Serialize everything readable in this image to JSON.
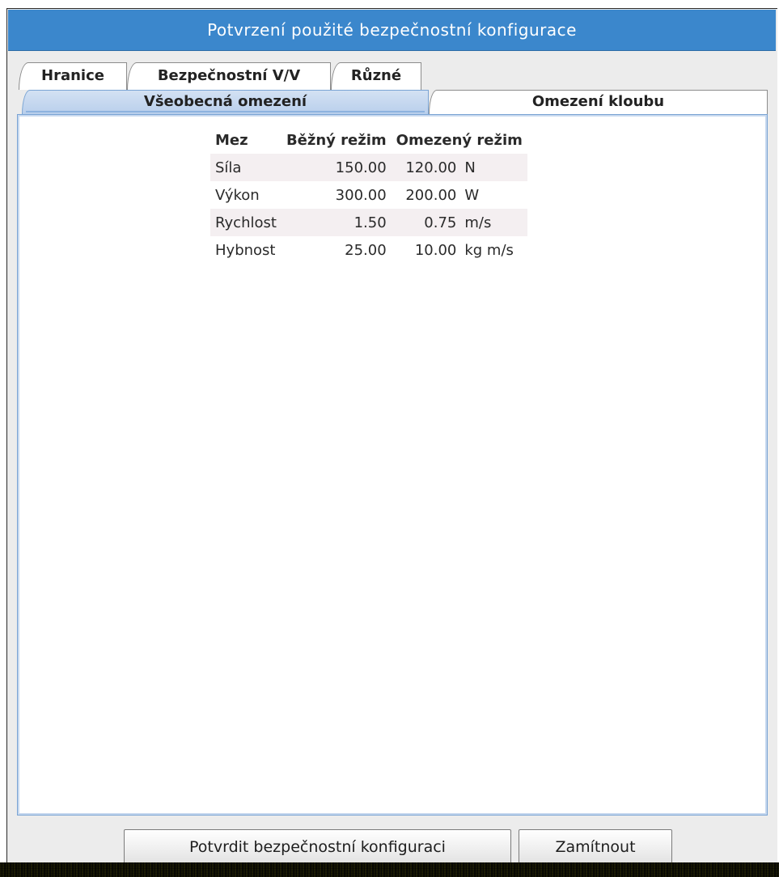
{
  "dialog": {
    "title": "Potvrzení použité bezpečnostní konfigurace"
  },
  "tabs": {
    "row1": [
      {
        "label": "Hranice"
      },
      {
        "label": "Bezpečnostní V/V"
      },
      {
        "label": "Různé"
      }
    ],
    "row2": [
      {
        "label": "Všeobecná omezení",
        "selected": true
      },
      {
        "label": "Omezení kloubu",
        "selected": false
      }
    ]
  },
  "limits_table": {
    "headers": [
      "Mez",
      "Běžný režim",
      "Omezený režim"
    ],
    "rows": [
      {
        "name": "Síla",
        "normal": "150.00",
        "reduced": "120.00",
        "unit": "N"
      },
      {
        "name": "Výkon",
        "normal": "300.00",
        "reduced": "200.00",
        "unit": "W"
      },
      {
        "name": "Rychlost",
        "normal": "1.50",
        "reduced": "0.75",
        "unit": "m/s"
      },
      {
        "name": "Hybnost",
        "normal": "25.00",
        "reduced": "10.00",
        "unit": "kg m/s"
      }
    ]
  },
  "buttons": {
    "confirm": "Potvrdit bezpečnostní konfiguraci",
    "reject": "Zamítnout"
  },
  "colors": {
    "titlebar": "#3b87cc",
    "selected_tab": "#c6d8f0",
    "row_shade": "#f4eff1"
  }
}
